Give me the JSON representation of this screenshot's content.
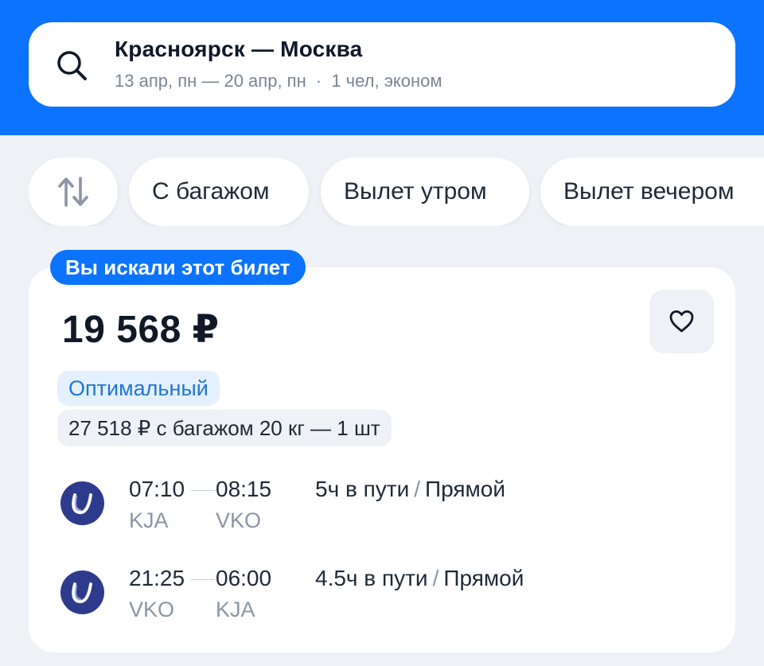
{
  "search": {
    "route": "Красноярск — Москва",
    "dates": "13 апр, пн — 20 апр, пн",
    "passengers": "1 чел, эконом",
    "separator": "·"
  },
  "filters": {
    "sort_icon": "sort-arrows-icon",
    "chips": [
      "С багажом",
      "Вылет утром",
      "Вылет вечером"
    ]
  },
  "ticket": {
    "badge": "Вы искали этот билет",
    "price": "19 568 ₽",
    "tag": "Оптимальный",
    "baggage_offer": "27 518 ₽ с багажом 20 кг — 1 шт",
    "favorite_icon": "heart-icon",
    "segments": [
      {
        "dep_time": "07:10",
        "arr_time": "08:15",
        "dep_code": "KJA",
        "arr_code": "VKO",
        "duration": "5ч в пути",
        "divider": "/",
        "type": "Прямой"
      },
      {
        "dep_time": "21:25",
        "arr_time": "06:00",
        "dep_code": "VKO",
        "arr_code": "KJA",
        "duration": "4.5ч в пути",
        "divider": "/",
        "type": "Прямой"
      }
    ]
  },
  "colors": {
    "brand_blue": "#0c73fe",
    "background": "#eef1f5",
    "tag_text": "#2276d2",
    "airline_logo": "#2e3a8c"
  }
}
